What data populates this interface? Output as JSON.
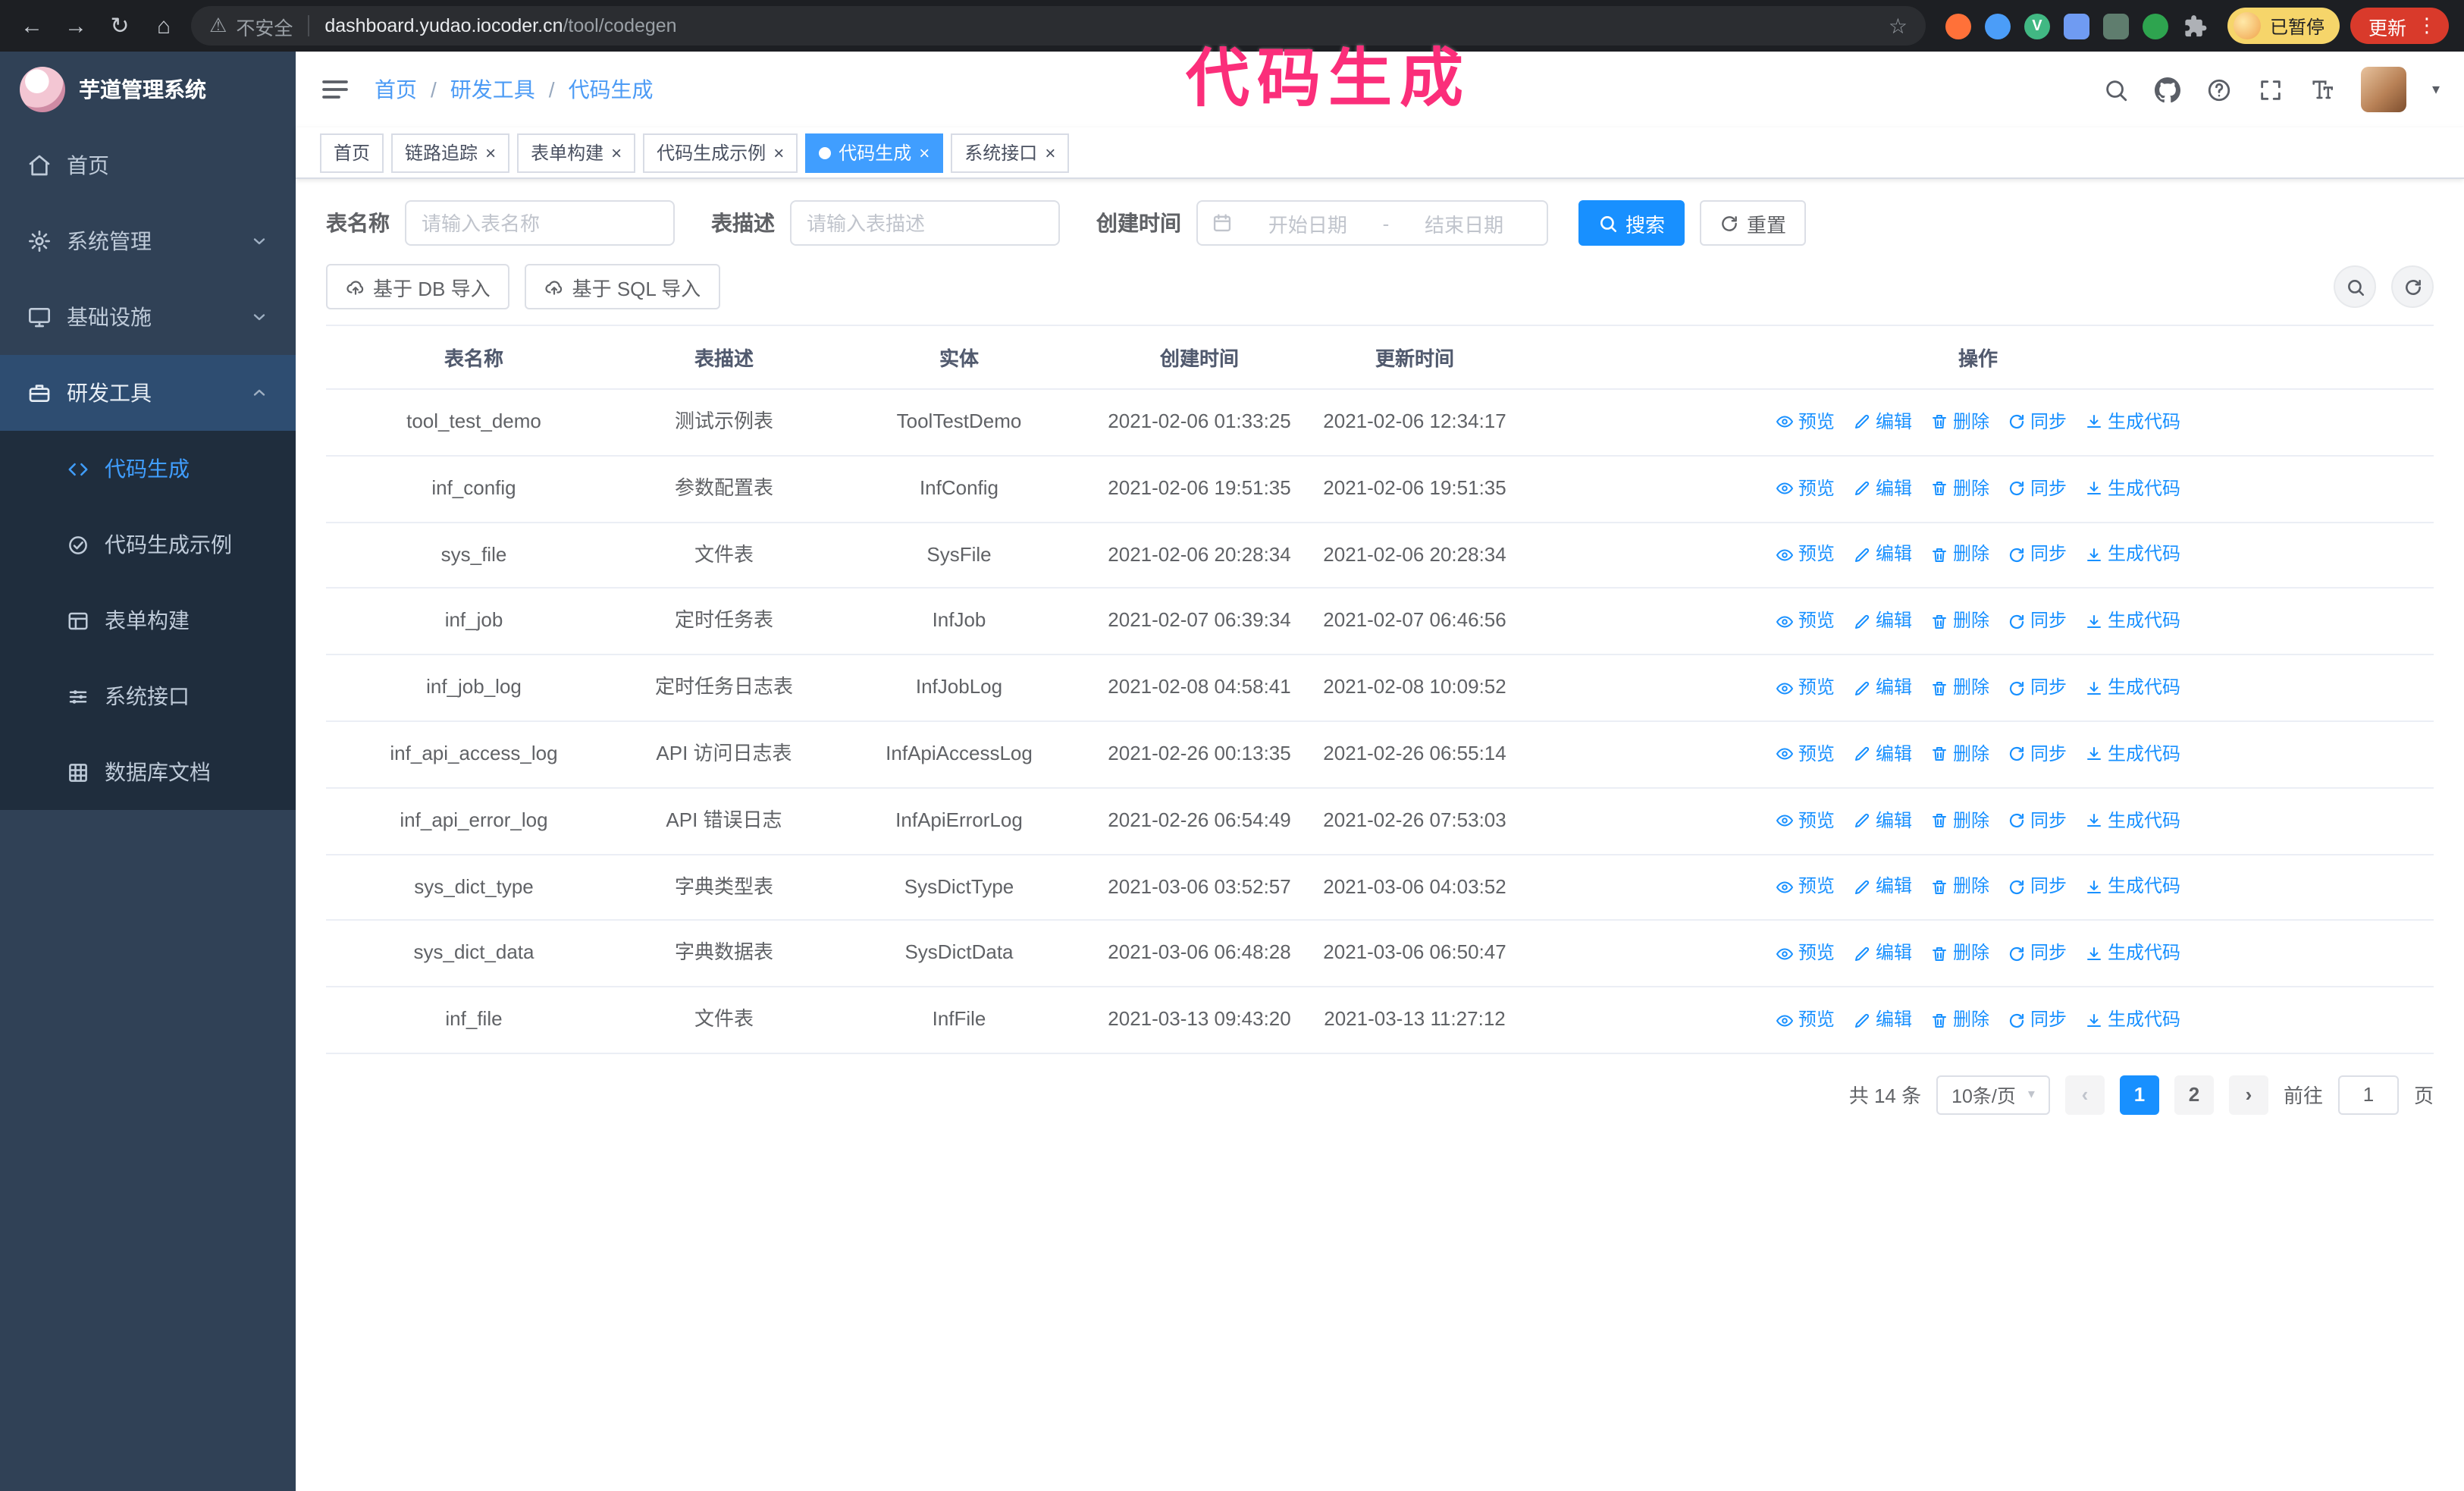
{
  "annotation": {
    "text": "代码生成",
    "color": "#fb2e7a"
  },
  "browser": {
    "security_label": "不安全",
    "url_domain": "dashboard.yudao.iocoder.cn",
    "url_path": "/tool/codegen",
    "profile_badge": "已暂停",
    "update_button": "更新"
  },
  "sidebar": {
    "logo_title": "芋道管理系统",
    "items": [
      {
        "label": "首页"
      },
      {
        "label": "系统管理"
      },
      {
        "label": "基础设施"
      },
      {
        "label": "研发工具"
      }
    ],
    "submenu": [
      {
        "label": "代码生成",
        "active": true
      },
      {
        "label": "代码生成示例"
      },
      {
        "label": "表单构建"
      },
      {
        "label": "系统接口"
      },
      {
        "label": "数据库文档"
      }
    ]
  },
  "header": {
    "breadcrumb": [
      "首页",
      "研发工具",
      "代码生成"
    ]
  },
  "tabs": [
    {
      "label": "首页",
      "closable": false,
      "active": false
    },
    {
      "label": "链路追踪",
      "closable": true,
      "active": false
    },
    {
      "label": "表单构建",
      "closable": true,
      "active": false
    },
    {
      "label": "代码生成示例",
      "closable": true,
      "active": false
    },
    {
      "label": "代码生成",
      "closable": true,
      "active": true
    },
    {
      "label": "系统接口",
      "closable": true,
      "active": false
    }
  ],
  "filters": {
    "table_name_label": "表名称",
    "table_name_placeholder": "请输入表名称",
    "table_desc_label": "表描述",
    "table_desc_placeholder": "请输入表描述",
    "create_time_label": "创建时间",
    "date_start_placeholder": "开始日期",
    "date_separator": "-",
    "date_end_placeholder": "结束日期",
    "search_button": "搜索",
    "reset_button": "重置"
  },
  "toolbar": {
    "import_db_button": "基于 DB 导入",
    "import_sql_button": "基于 SQL 导入"
  },
  "table": {
    "columns": [
      "表名称",
      "表描述",
      "实体",
      "创建时间",
      "更新时间",
      "操作"
    ],
    "actions": [
      {
        "id": "preview",
        "label": "预览",
        "icon": "eye"
      },
      {
        "id": "edit",
        "label": "编辑",
        "icon": "pencil"
      },
      {
        "id": "delete",
        "label": "删除",
        "icon": "trash"
      },
      {
        "id": "sync",
        "label": "同步",
        "icon": "refresh"
      },
      {
        "id": "generate",
        "label": "生成代码",
        "icon": "download"
      }
    ],
    "rows": [
      {
        "name": "tool_test_demo",
        "desc": "测试示例表",
        "entity": "ToolTestDemo",
        "created": "2021-02-06 01:33:25",
        "updated": "2021-02-06 12:34:17"
      },
      {
        "name": "inf_config",
        "desc": "参数配置表",
        "entity": "InfConfig",
        "created": "2021-02-06 19:51:35",
        "updated": "2021-02-06 19:51:35"
      },
      {
        "name": "sys_file",
        "desc": "文件表",
        "entity": "SysFile",
        "created": "2021-02-06 20:28:34",
        "updated": "2021-02-06 20:28:34"
      },
      {
        "name": "inf_job",
        "desc": "定时任务表",
        "entity": "InfJob",
        "created": "2021-02-07 06:39:34",
        "updated": "2021-02-07 06:46:56"
      },
      {
        "name": "inf_job_log",
        "desc": "定时任务日志表",
        "entity": "InfJobLog",
        "created": "2021-02-08 04:58:41",
        "updated": "2021-02-08 10:09:52"
      },
      {
        "name": "inf_api_access_log",
        "desc": "API 访问日志表",
        "entity": "InfApiAccessLog",
        "created": "2021-02-26 00:13:35",
        "updated": "2021-02-26 06:55:14"
      },
      {
        "name": "inf_api_error_log",
        "desc": "API 错误日志",
        "entity": "InfApiErrorLog",
        "created": "2021-02-26 06:54:49",
        "updated": "2021-02-26 07:53:03"
      },
      {
        "name": "sys_dict_type",
        "desc": "字典类型表",
        "entity": "SysDictType",
        "created": "2021-03-06 03:52:57",
        "updated": "2021-03-06 04:03:52"
      },
      {
        "name": "sys_dict_data",
        "desc": "字典数据表",
        "entity": "SysDictData",
        "created": "2021-03-06 06:48:28",
        "updated": "2021-03-06 06:50:47"
      },
      {
        "name": "inf_file",
        "desc": "文件表",
        "entity": "InfFile",
        "created": "2021-03-13 09:43:20",
        "updated": "2021-03-13 11:27:12"
      }
    ]
  },
  "pagination": {
    "total_text": "共 14 条",
    "page_size": "10条/页",
    "pages": [
      "1",
      "2"
    ],
    "active_page": "1",
    "goto_label": "前往",
    "goto_value": "1",
    "goto_suffix": "页"
  }
}
